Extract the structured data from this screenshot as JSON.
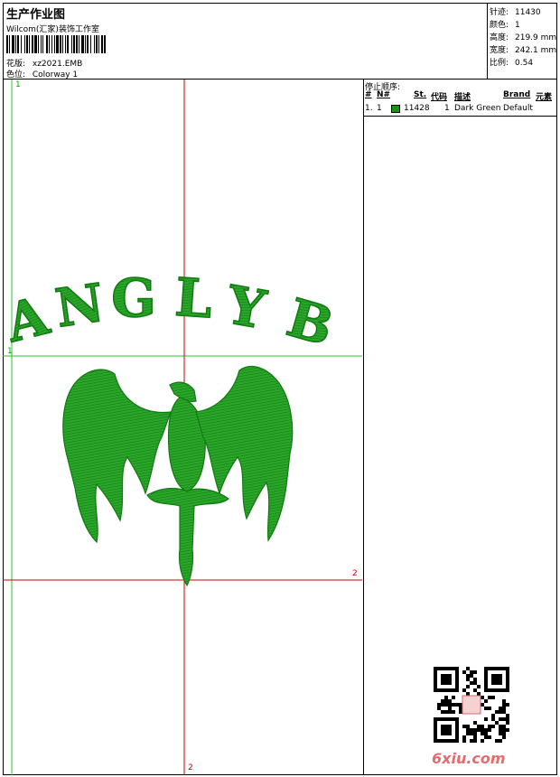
{
  "header": {
    "title": "生产作业图",
    "company": "Wilcom(汇家)装饰工作室",
    "design_label": "花版:",
    "design_value": "xz2021.EMB",
    "colorway_label": "色位:",
    "colorway_value": "Colorway 1"
  },
  "stats": [
    {
      "label": "针迹:",
      "value": "11430"
    },
    {
      "label": "颜色:",
      "value": "1"
    },
    {
      "label": "高度:",
      "value": "219.9 mm"
    },
    {
      "label": "宽度:",
      "value": "242.1 mm"
    },
    {
      "label": "比例:",
      "value": "0.54"
    }
  ],
  "stop_sequence": {
    "title": "停止顺序:",
    "columns": [
      "#",
      "N#",
      "St.",
      "代码",
      "描述",
      "Brand",
      "元素"
    ],
    "rows": [
      {
        "index": "1.",
        "needle": "1",
        "color": "#119911",
        "stitches": "11428",
        "code": "1",
        "description": "Dark Green",
        "brand": "Default"
      }
    ]
  },
  "design": {
    "lettering": [
      "A",
      "N",
      "G",
      "L",
      "Y",
      "B"
    ],
    "thread_color": "#1a9a1a"
  },
  "markers": {
    "green_top": "1",
    "green_left": "1",
    "red_right": "2",
    "red_bottom": "2"
  },
  "watermark": {
    "site": "6xiu.com"
  }
}
